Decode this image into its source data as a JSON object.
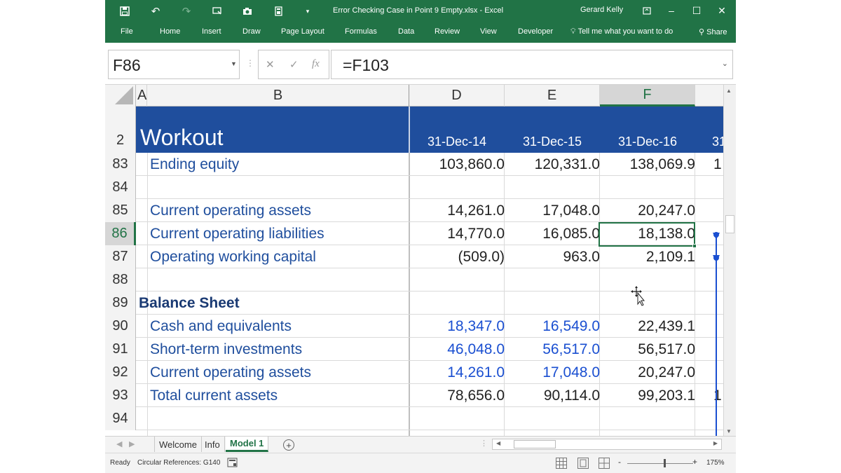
{
  "title_bar": {
    "doc_title": "Error Checking Case in Point 9 Empty.xlsx  -  Excel",
    "user": "Gerard Kelly"
  },
  "tabs": [
    "File",
    "Home",
    "Insert",
    "Draw",
    "Page Layout",
    "Formulas",
    "Data",
    "Review",
    "View",
    "Developer"
  ],
  "tell_me": "Tell me what you want to do",
  "share": "Share",
  "formula_bar": {
    "name_box": "F86",
    "fx": "fx",
    "formula": "=F103"
  },
  "columns": [
    "A",
    "B",
    "D",
    "E",
    "F"
  ],
  "header_row": {
    "row_number": "2",
    "title": "Workout",
    "dates": [
      "31-Dec-14",
      "31-Dec-15",
      "31-Dec-16",
      "31"
    ]
  },
  "rows": [
    {
      "num": "83",
      "label": "Ending equity",
      "style": "indent",
      "D": "103,860.0",
      "E": "120,331.0",
      "F": "138,069.9",
      "G": "1",
      "color": "blk"
    },
    {
      "num": "84",
      "label": "",
      "style": "indent",
      "D": "",
      "E": "",
      "F": "",
      "G": "",
      "color": "blk"
    },
    {
      "num": "85",
      "label": "Current operating assets",
      "style": "indent",
      "D": "14,261.0",
      "E": "17,048.0",
      "F": "20,247.0",
      "G": "",
      "color": "blk"
    },
    {
      "num": "86",
      "label": "Current operating liabilities",
      "style": "indent",
      "D": "14,770.0",
      "E": "16,085.0",
      "F": "18,138.0",
      "G": "",
      "color": "blk"
    },
    {
      "num": "87",
      "label": "Operating working capital",
      "style": "indent",
      "D": "(509.0)",
      "E": "963.0",
      "F": "2,109.1",
      "G": "",
      "color": "blk"
    },
    {
      "num": "88",
      "label": "",
      "style": "indent",
      "D": "",
      "E": "",
      "F": "",
      "G": "",
      "color": "blk"
    },
    {
      "num": "89",
      "label": "Balance Sheet",
      "style": "bold",
      "D": "",
      "E": "",
      "F": "",
      "G": "",
      "color": "blk"
    },
    {
      "num": "90",
      "label": "Cash and equivalents",
      "style": "indent",
      "D": "18,347.0",
      "E": "16,549.0",
      "F": "22,439.1",
      "G": "",
      "color": "blu"
    },
    {
      "num": "91",
      "label": "Short-term investments",
      "style": "indent",
      "D": "46,048.0",
      "E": "56,517.0",
      "F": "56,517.0",
      "G": "",
      "color": "blu"
    },
    {
      "num": "92",
      "label": "Current operating assets",
      "style": "indent",
      "D": "14,261.0",
      "E": "17,048.0",
      "F": "20,247.0",
      "G": "",
      "color": "blu"
    },
    {
      "num": "93",
      "label": "Total current assets",
      "style": "indent",
      "D": "78,656.0",
      "E": "90,114.0",
      "F": "99,203.1",
      "G": "1",
      "color": "blk"
    },
    {
      "num": "94",
      "label": "",
      "style": "indent",
      "D": "",
      "E": "",
      "F": "",
      "G": "",
      "color": "blk"
    }
  ],
  "selected_row": "86",
  "sheet_tabs": [
    "Welcome",
    "Info",
    "Model 1"
  ],
  "active_sheet": "Model 1",
  "status": {
    "ready": "Ready",
    "circular": "Circular References: G140",
    "zoom": "175%"
  },
  "colors": {
    "accent": "#217346",
    "header_band": "#1F4E9D",
    "input_blue": "#1a4fd1",
    "trace_arrow": "#1a4fd1"
  }
}
